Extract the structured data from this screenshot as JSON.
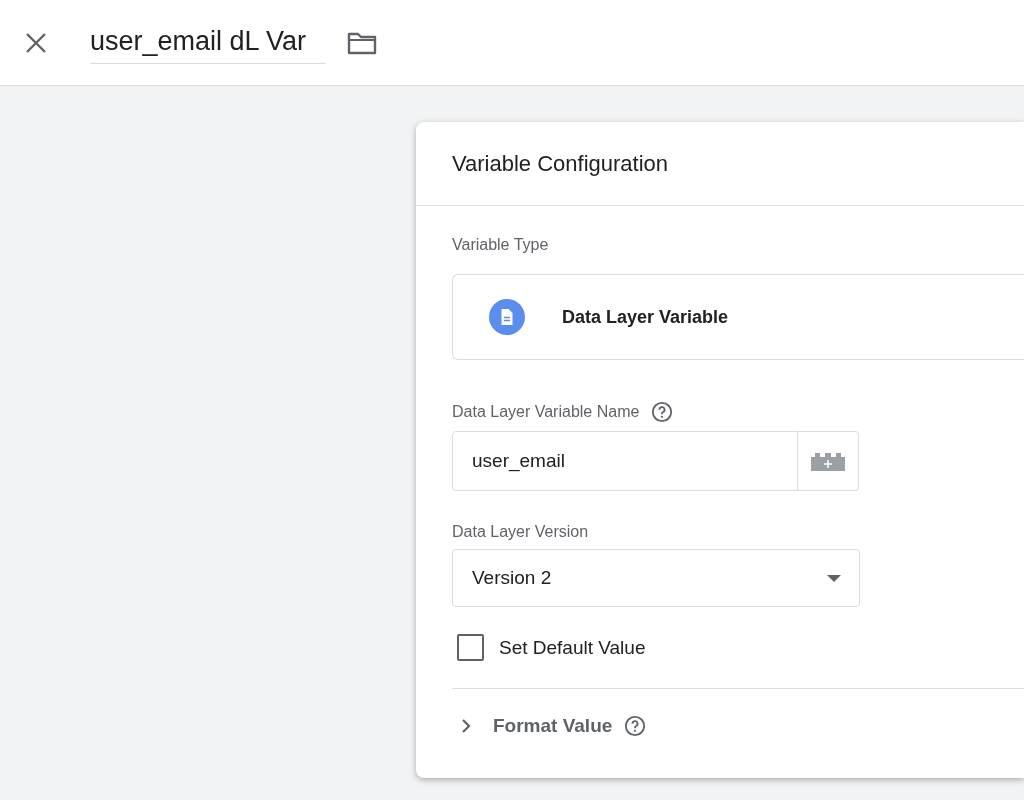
{
  "header": {
    "title": "user_email dL Var"
  },
  "panel": {
    "title": "Variable Configuration",
    "variable_type": {
      "label": "Variable Type",
      "value": "Data Layer Variable"
    },
    "name_field": {
      "label": "Data Layer Variable Name",
      "value": "user_email"
    },
    "version_field": {
      "label": "Data Layer Version",
      "value": "Version 2"
    },
    "default_value": {
      "label": "Set Default Value",
      "checked": false
    },
    "format_value": {
      "label": "Format Value",
      "expanded": false
    }
  }
}
